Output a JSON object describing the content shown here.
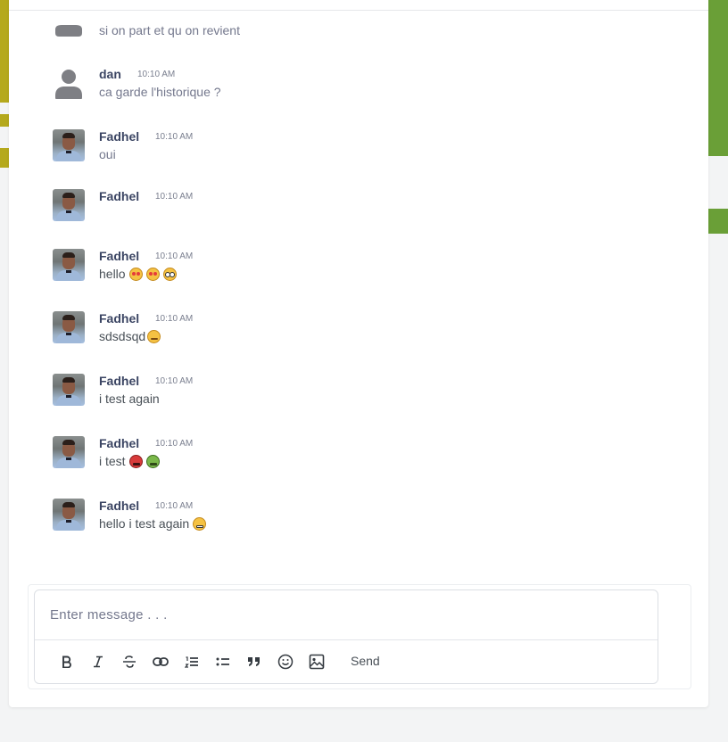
{
  "messages": [
    {
      "name": "",
      "time": "",
      "text": "si on part et qu on revient",
      "avatar": "generic",
      "emojis": []
    },
    {
      "name": "dan",
      "time": "10:10 AM",
      "text": "ca garde l'historique ?",
      "avatar": "generic",
      "emojis": []
    },
    {
      "name": "Fadhel",
      "time": "10:10 AM",
      "text": "oui",
      "avatar": "photo",
      "emojis": []
    },
    {
      "name": "Fadhel",
      "time": "10:10 AM",
      "text": "",
      "avatar": "photo",
      "emojis": []
    },
    {
      "name": "Fadhel",
      "time": "10:10 AM",
      "text": "hello",
      "avatar": "photo",
      "emojis": [
        "heart-eyes-emoji",
        "heart-eyes-emoji",
        "flushed-emoji"
      ]
    },
    {
      "name": "Fadhel",
      "time": "10:10 AM",
      "text": "sdsdsqd",
      "avatar": "photo",
      "emojis": [
        "smirk-emoji"
      ]
    },
    {
      "name": "Fadhel",
      "time": "10:10 AM",
      "text": "i test again",
      "avatar": "photo",
      "emojis": []
    },
    {
      "name": "Fadhel",
      "time": "10:10 AM",
      "text": "i test",
      "avatar": "photo",
      "emojis": [
        "angry-emoji",
        "nauseated-emoji"
      ]
    },
    {
      "name": "Fadhel",
      "time": "10:10 AM",
      "text": "hello i test again",
      "avatar": "photo",
      "emojis": [
        "grimace-emoji"
      ]
    }
  ],
  "composer": {
    "placeholder": "Enter message . . .",
    "send_label": "Send",
    "tools": [
      "bold-icon",
      "italic-icon",
      "strikethrough-icon",
      "link-icon",
      "ordered-list-icon",
      "bullet-list-icon",
      "quote-icon",
      "emoji-icon",
      "image-icon"
    ]
  },
  "colors": {
    "name": "#3b4563",
    "text": "#495057",
    "muted": "#74788d",
    "accent_left": "#b5a91c",
    "accent_right": "#6a9f37"
  }
}
